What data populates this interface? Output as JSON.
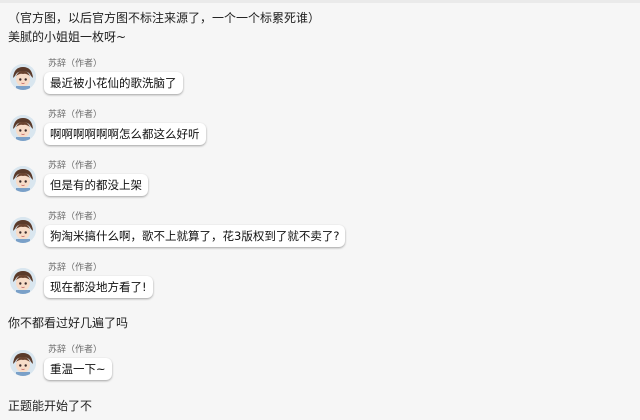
{
  "header_lines": [
    "（官方图，以后官方图不标注来源了，一个一个标累死谁）",
    "美腻的小姐姐一枚呀~"
  ],
  "messages": [
    {
      "sender": "苏辞（作者）",
      "text": "最近被小花仙的歌洗脑了"
    },
    {
      "sender": "苏辞（作者）",
      "text": "啊啊啊啊啊啊怎么都这么好听"
    },
    {
      "sender": "苏辞（作者）",
      "text": "但是有的都没上架"
    },
    {
      "sender": "苏辞（作者）",
      "text": "狗淘米搞什么啊，歌不上就算了，花3版权到了就不卖了?"
    },
    {
      "sender": "苏辞（作者）",
      "text": "现在都没地方看了!"
    },
    {
      "sender": "苏辞（作者）",
      "text": "重温一下~"
    }
  ],
  "interludes": [
    "你不都看过好几遍了吗",
    "正题能开始了不"
  ],
  "colors": {
    "background": "#f6f6f6",
    "bubble": "#ffffff",
    "sender_name": "#6b6b6b"
  },
  "icons": {
    "avatar": "anime-avatar-icon"
  }
}
